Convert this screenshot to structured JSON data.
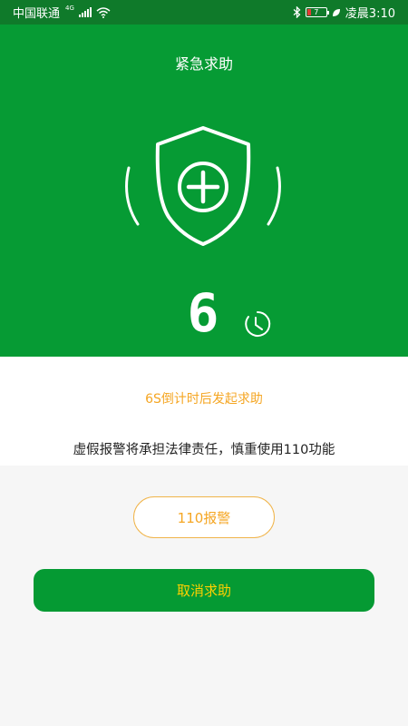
{
  "status_bar": {
    "carrier": "中国联通",
    "network_type": "4G",
    "battery_level": "7",
    "time": "凌晨3:10",
    "icons": [
      "signal-icon",
      "wifi-icon",
      "bluetooth-icon",
      "battery-icon",
      "leaf-icon"
    ]
  },
  "hero": {
    "title": "紧急求助",
    "countdown_value": "6",
    "icons": [
      "shield-plus-icon",
      "clock-icon"
    ]
  },
  "notice": {
    "countdown_text": "6S倒计时后发起求助",
    "warning_text": "虚假报警将承担法律责任，慎重使用110功能"
  },
  "actions": {
    "police_label": "110报警",
    "cancel_label": "取消求助"
  },
  "colors": {
    "primary_green": "#069b34",
    "status_bar_green": "#0f7a2a",
    "accent_orange": "#f5a623",
    "cancel_text_yellow": "#ffd000"
  }
}
